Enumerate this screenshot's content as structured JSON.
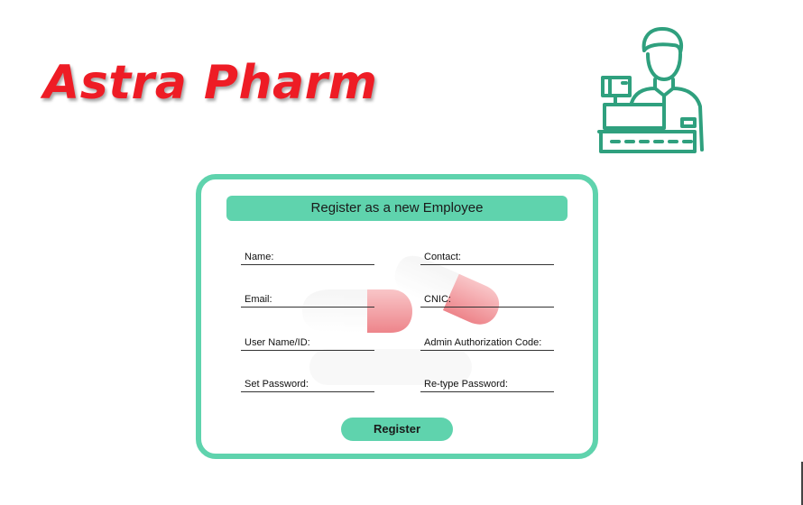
{
  "brand": {
    "name": "Astra Pharm",
    "color": "#ee1c25"
  },
  "icons": {
    "cashier": "cashier-register-icon",
    "pills": "medicine-capsules-icon"
  },
  "form": {
    "title": "Register as a new Employee",
    "accent_color": "#5fd3ad",
    "fields": [
      {
        "label": "Name:"
      },
      {
        "label": "Contact:"
      },
      {
        "label": "Email:"
      },
      {
        "label": "CNIC:"
      },
      {
        "label": "User Name/ID:"
      },
      {
        "label": "Admin Authorization Code:"
      },
      {
        "label": "Set Password:"
      },
      {
        "label": "Re-type Password:"
      }
    ],
    "submit_label": "Register"
  }
}
